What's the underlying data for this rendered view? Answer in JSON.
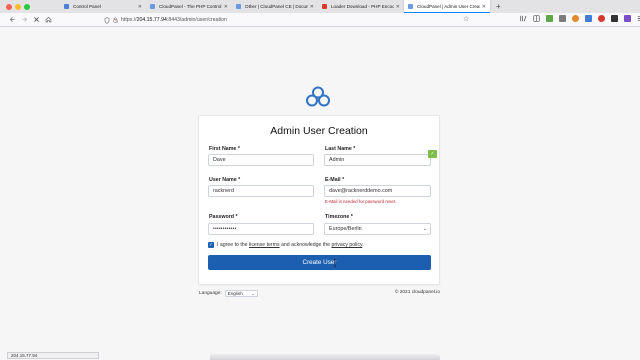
{
  "browser": {
    "tabs": [
      {
        "title": "Control Panel",
        "favicon_color": "#4f7fd8",
        "active": false
      },
      {
        "title": "CloudPanel - The PHP Control Pa",
        "favicon_color": "#6a9ae0",
        "active": false
      },
      {
        "title": "Other | CloudPanel CE | Documen",
        "favicon_color": "#6a9ae0",
        "active": false
      },
      {
        "title": "Loader Download - PHP Encoder",
        "favicon_color": "#d83b2e",
        "active": false
      },
      {
        "title": "CloudPanel | Admin User Creatio",
        "favicon_color": "#6a9ae0",
        "active": true
      }
    ],
    "close_glyph": "✕",
    "new_tab_glyph": "+",
    "url_prefix": "https://",
    "url_host": "204.15.77.94",
    "url_path": ":8443/admin/user/creation",
    "toolbar_icons": [
      "library-icon",
      "reader-icon",
      "extension-green-icon",
      "extension-grid-icon",
      "extension-orange-icon",
      "extension-blue-icon",
      "extension-red-icon",
      "extension-dark-icon",
      "extension-purple-icon",
      "menu-icon"
    ]
  },
  "page": {
    "title": "Admin User Creation",
    "fields": {
      "first_name": {
        "label": "First Name *",
        "value": "Dave"
      },
      "last_name": {
        "label": "Last Name *",
        "value": "Admin"
      },
      "user_name": {
        "label": "User Name *",
        "value": "racknerd"
      },
      "email": {
        "label": "E-Mail *",
        "value": "dave@racknerddemo.com",
        "hint": "E-Mail is needed for password reset."
      },
      "password": {
        "label": "Password *",
        "value": "••••••••••••"
      },
      "timezone": {
        "label": "Timezone *",
        "value": "Europe/Berlin"
      }
    },
    "agree": {
      "prefix": "I agree to the ",
      "terms": "license terms",
      "middle": " and acknowledge the ",
      "privacy": "privacy policy",
      "suffix": "."
    },
    "submit_label": "Create User",
    "language_label": "Language:",
    "language_value": "English",
    "copyright": "© 2021 cloudpanel.io",
    "status_url": "204.15.77.94"
  },
  "colors": {
    "accent": "#1c5fb0",
    "error": "#c0272d",
    "logo": "#2f73c3"
  }
}
